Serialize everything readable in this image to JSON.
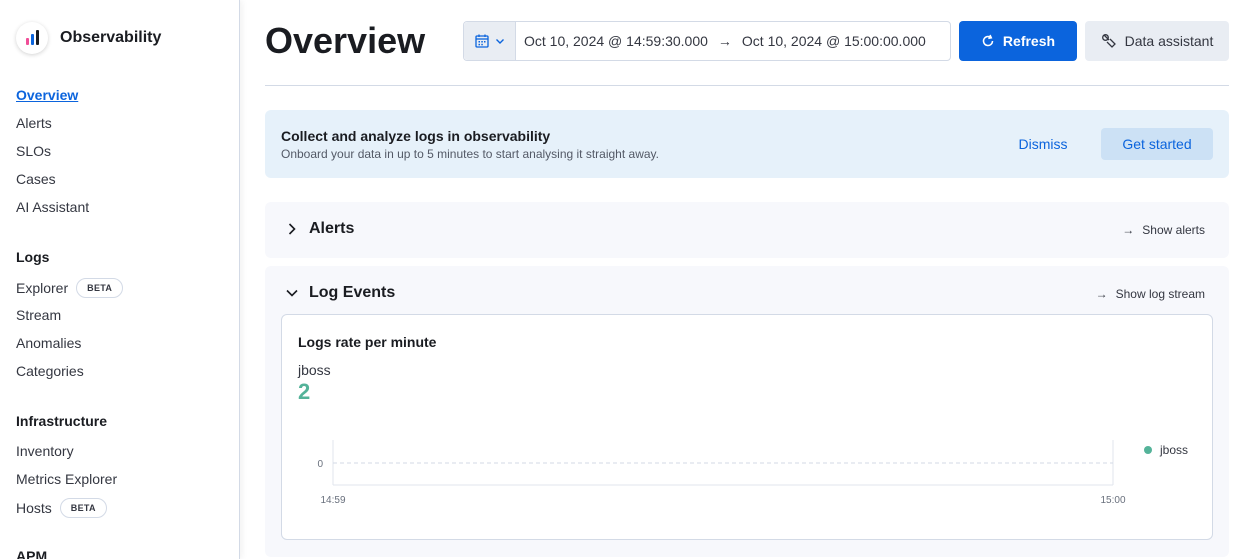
{
  "app": {
    "title": "Observability"
  },
  "sidebar": {
    "top_items": [
      {
        "label": "Overview",
        "active": true
      },
      {
        "label": "Alerts"
      },
      {
        "label": "SLOs"
      },
      {
        "label": "Cases"
      },
      {
        "label": "AI Assistant"
      }
    ],
    "sections": [
      {
        "heading": "Logs",
        "items": [
          {
            "label": "Explorer",
            "badge": "BETA"
          },
          {
            "label": "Stream"
          },
          {
            "label": "Anomalies"
          },
          {
            "label": "Categories"
          }
        ]
      },
      {
        "heading": "Infrastructure",
        "items": [
          {
            "label": "Inventory"
          },
          {
            "label": "Metrics Explorer"
          },
          {
            "label": "Hosts",
            "badge": "BETA"
          }
        ]
      },
      {
        "heading": "APM"
      }
    ]
  },
  "header": {
    "title": "Overview",
    "date_start": "Oct 10, 2024 @ 14:59:30.000",
    "date_end": "Oct 10, 2024 @ 15:00:00.000",
    "refresh_label": "Refresh",
    "assistant_label": "Data assistant"
  },
  "callout": {
    "title": "Collect and analyze logs in observability",
    "description": "Onboard your data in up to 5 minutes to start analysing it straight away.",
    "dismiss_label": "Dismiss",
    "cta_label": "Get started"
  },
  "alerts_panel": {
    "title": "Alerts",
    "link_label": "Show alerts",
    "expanded": false
  },
  "log_events_panel": {
    "title": "Log Events",
    "link_label": "Show log stream",
    "expanded": true,
    "chart_card": {
      "title": "Logs rate per minute",
      "series_name": "jboss",
      "series_value": "2"
    }
  },
  "colors": {
    "accent": "#0b64dd",
    "series": "#54b399",
    "callout_bg": "#e6f1fa"
  },
  "chart_data": {
    "type": "line",
    "title": "Logs rate per minute",
    "x": [
      "14:59",
      "15:00"
    ],
    "xlabel": "",
    "ylabel": "",
    "y_ticks": [
      "0"
    ],
    "series": [
      {
        "name": "jboss",
        "values": [
          0,
          0
        ]
      }
    ],
    "legend": "right",
    "grid": false
  }
}
